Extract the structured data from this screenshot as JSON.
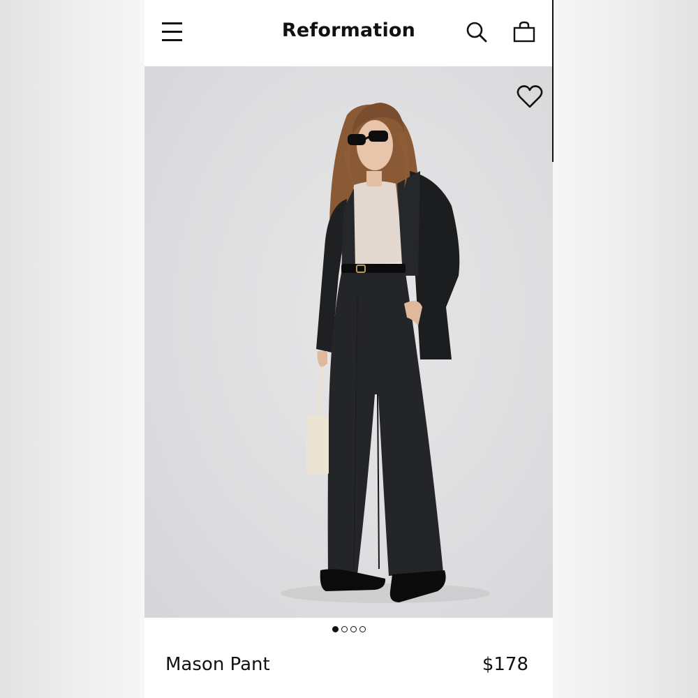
{
  "header": {
    "brand": "Reformation",
    "menu_icon": "hamburger-menu-icon",
    "search_icon": "search-icon",
    "bag_icon": "shopping-bag-icon"
  },
  "product": {
    "name": "Mason Pant",
    "price": "$178",
    "favorite_icon": "heart-outline-icon"
  },
  "gallery": {
    "total_images": 4,
    "active_index": 0
  },
  "colors": {
    "text": "#111111",
    "background": "#ffffff",
    "hero_background": "#dedee0"
  }
}
